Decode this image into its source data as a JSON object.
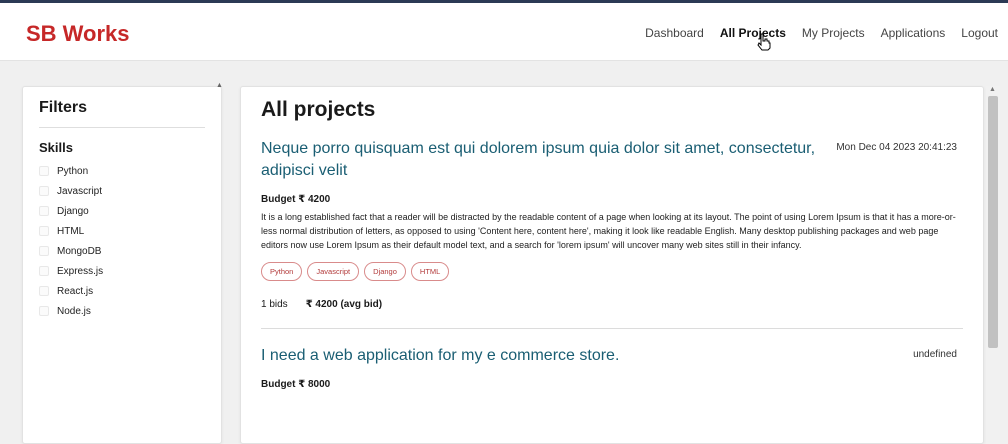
{
  "brand": "SB Works",
  "nav": [
    "Dashboard",
    "All Projects",
    "My Projects",
    "Applications",
    "Logout"
  ],
  "filters": {
    "title": "Filters",
    "skills_title": "Skills",
    "skills": [
      "Python",
      "Javascript",
      "Django",
      "HTML",
      "MongoDB",
      "Express.js",
      "React.js",
      "Node.js"
    ]
  },
  "main": {
    "title": "All projects",
    "projects": [
      {
        "title": "Neque porro quisquam est qui dolorem ipsum quia dolor sit amet, consectetur, adipisci velit",
        "date": "Mon Dec 04 2023 20:41:23",
        "budget": "Budget ₹ 4200",
        "description": "It is a long established fact that a reader will be distracted by the readable content of a page when looking at its layout. The point of using Lorem Ipsum is that it has a more-or-less normal distribution of letters, as opposed to using 'Content here, content here', making it look like readable English. Many desktop publishing packages and web page editors now use Lorem Ipsum as their default model text, and a search for 'lorem ipsum' will uncover many web sites still in their infancy.",
        "tags": [
          "Python",
          "Javascript",
          "Django",
          "HTML"
        ],
        "bids": "1 bids",
        "avg_bid": "₹ 4200 (avg bid)"
      },
      {
        "title": "I need a web application for my e commerce store.",
        "date": "undefined",
        "budget": "Budget ₹ 8000"
      }
    ]
  }
}
